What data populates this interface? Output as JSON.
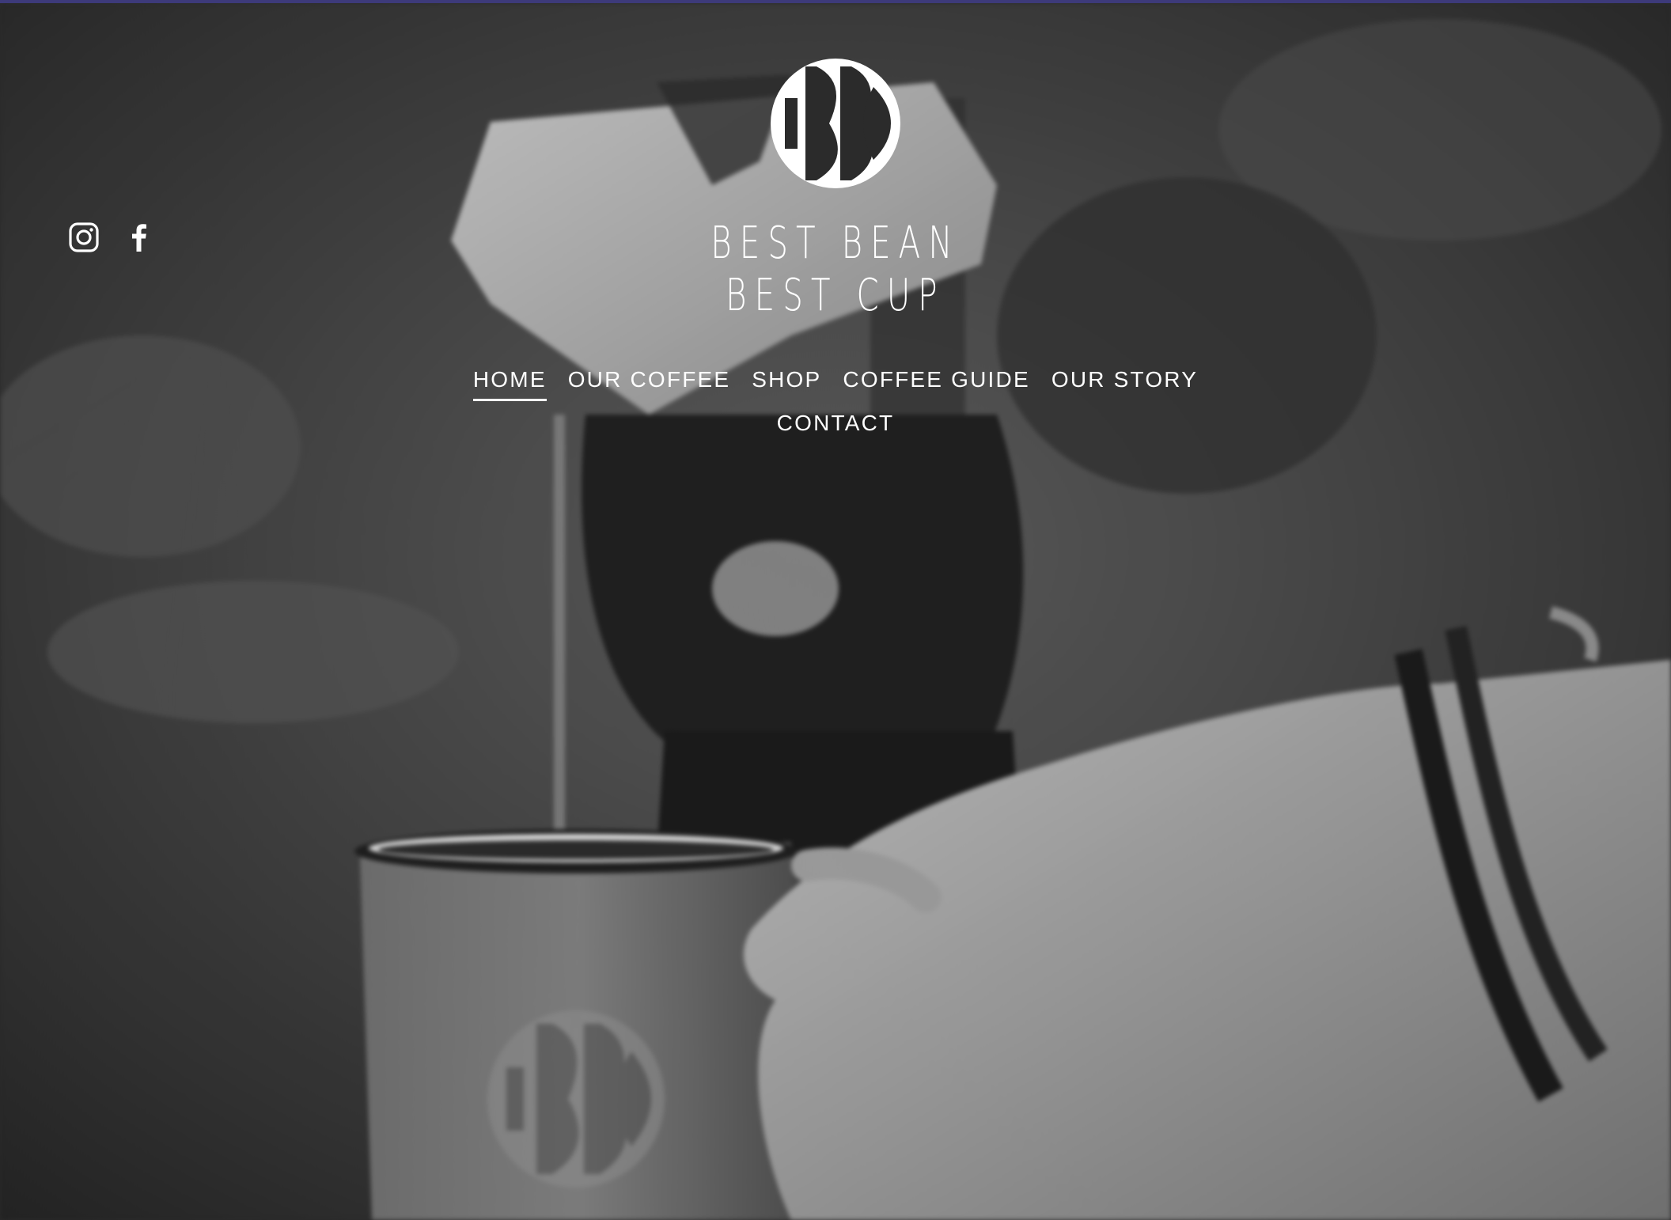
{
  "brand": {
    "logo_icon": "bbbc-monogram-icon",
    "line1": "BEST BEAN",
    "line2": "BEST CUP"
  },
  "social": [
    {
      "name": "instagram",
      "icon": "instagram-icon"
    },
    {
      "name": "facebook",
      "icon": "facebook-icon"
    }
  ],
  "nav": {
    "items": [
      {
        "label": "HOME",
        "active": true
      },
      {
        "label": "OUR COFFEE"
      },
      {
        "label": "SHOP"
      },
      {
        "label": "COFFEE GUIDE"
      },
      {
        "label": "OUR STORY"
      },
      {
        "label": "CONTACT"
      }
    ]
  },
  "colors": {
    "accent_bar": "#3d3a7a",
    "text": "#ffffff"
  }
}
